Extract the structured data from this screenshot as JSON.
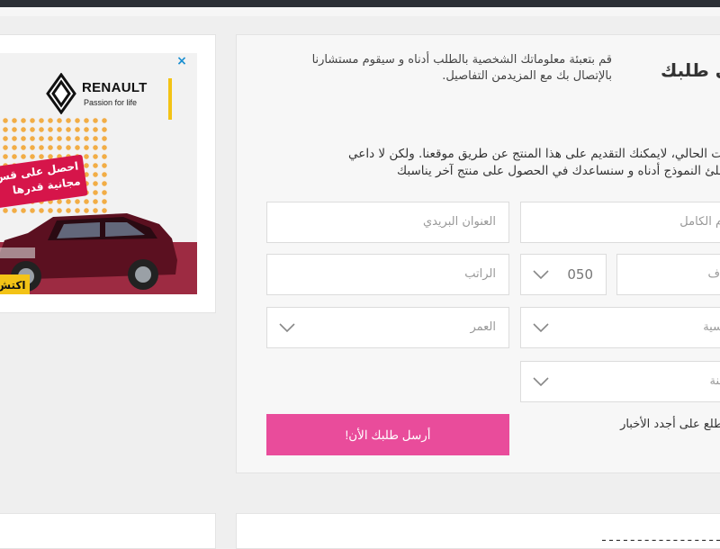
{
  "ad": {
    "brand": "RENAULT",
    "tagline": "Passion for life",
    "ribbon_line1": "احصل على قس",
    "ribbon_line2": "مجانية قدرها",
    "cta_label": "اكتش",
    "close_label": "×",
    "colors": {
      "ribbon": "#d6154a",
      "accent": "#f3c316",
      "car": "#5b1020"
    }
  },
  "form": {
    "title": "ى طلبك",
    "description": "قم بتعبئة معلوماتك الشخصية بالطلب أدناه و سيقوم مستشارنا بالإتصال بك مع المزيدمن التفاصيل.",
    "note_line1": "قت الحالي، لايمكنك التقديم على هذا المنتج عن طريق موقعنا. ولكن لا داعي",
    "note_line2": "املئ النموذج أدناه و سنساعدك في الحصول على منتج آخر يناسبك",
    "fields": {
      "full_name_placeholder": "م الكامل",
      "email_placeholder": "العنوان البريدي",
      "phone_placeholder": "ف",
      "phone_code": "050",
      "salary_placeholder": "الراتب",
      "nationality_placeholder": "سية",
      "age_placeholder": "العمر",
      "city_placeholder": "ينة"
    },
    "submit_label": "أرسل طلبك الأن!",
    "newsletter_line1": "ي مطلع على أجدد الأخبار",
    "newsletter_line2": ".",
    "accent_color": "#e94c9b"
  },
  "bottom": {
    "partial_text": "ـ ـ ـ ـ ـ ـ ـ ـ ـ ـ ـ ـ ـ ـ ـ ـ ـ"
  }
}
